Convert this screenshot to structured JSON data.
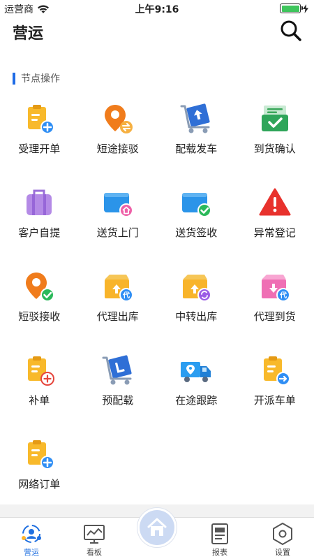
{
  "status_bar": {
    "carrier": "运营商",
    "time": "上午9:16",
    "battery_color": "#3ec55c"
  },
  "header": {
    "title": "营运",
    "search_icon": "search-icon"
  },
  "section": {
    "title": "节点操作",
    "accent_color": "#1e6be6"
  },
  "tiles": [
    {
      "label": "受理开单",
      "icon": "clipboard-add-icon"
    },
    {
      "label": "短途接驳",
      "icon": "location-exchange-icon"
    },
    {
      "label": "配载发车",
      "icon": "cart-up-icon"
    },
    {
      "label": "到货确认",
      "icon": "tray-check-icon"
    },
    {
      "label": "客户自提",
      "icon": "luggage-icon"
    },
    {
      "label": "送货上门",
      "icon": "folder-home-icon"
    },
    {
      "label": "送货签收",
      "icon": "folder-check-icon"
    },
    {
      "label": "异常登记",
      "icon": "warning-icon"
    },
    {
      "label": "短驳接收",
      "icon": "location-check-icon"
    },
    {
      "label": "代理出库",
      "icon": "box-out-agent-icon"
    },
    {
      "label": "中转出库",
      "icon": "box-transfer-icon"
    },
    {
      "label": "代理到货",
      "icon": "box-in-agent-icon"
    },
    {
      "label": "补单",
      "icon": "clipboard-add-red-icon"
    },
    {
      "label": "预配载",
      "icon": "cart-preload-icon"
    },
    {
      "label": "在途跟踪",
      "icon": "truck-track-icon"
    },
    {
      "label": "开派车单",
      "icon": "clipboard-dispatch-icon"
    },
    {
      "label": "网络订单",
      "icon": "clipboard-online-icon"
    }
  ],
  "tab_bar": {
    "tabs": [
      {
        "label": "营运",
        "icon": "operations-icon",
        "active": true
      },
      {
        "label": "看板",
        "icon": "dashboard-icon",
        "active": false
      },
      {
        "label": "",
        "icon": "home-icon",
        "active": false
      },
      {
        "label": "报表",
        "icon": "report-icon",
        "active": false
      },
      {
        "label": "设置",
        "icon": "settings-icon",
        "active": false
      }
    ],
    "active_color": "#1f6fe0",
    "inactive_color": "#444444"
  }
}
